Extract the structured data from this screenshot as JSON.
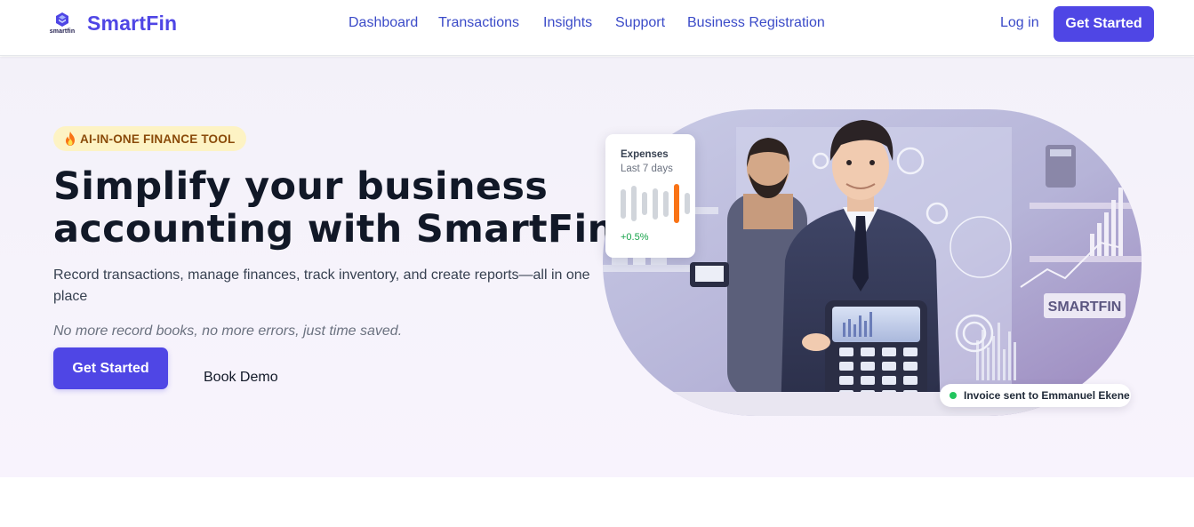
{
  "brand": {
    "name": "SmartFin",
    "logo_text": "smartfin"
  },
  "nav": {
    "items": [
      {
        "label": "Dashboard"
      },
      {
        "label": "Transactions"
      },
      {
        "label": "Insights"
      },
      {
        "label": "Support"
      },
      {
        "label": "Business Registration"
      }
    ],
    "login_label": "Log in",
    "cta_label": "Get Started"
  },
  "hero": {
    "badge": "AI-IN-ONE FINANCE TOOL",
    "headline": "Simplify your business accounting with SmartFin",
    "subtitle": "Record transactions, manage finances, track inventory, and create reports—all in one place",
    "tagline": "No more record books, no more errors, just time saved.",
    "primary_cta": "Get Started",
    "secondary_cta": "Book Demo"
  },
  "expense_card": {
    "title": "Expenses",
    "subtitle": "Last 7 days",
    "bars": [
      0.75,
      0.9,
      0.6,
      0.8,
      0.65,
      1.0,
      0.55
    ],
    "highlight_index": 5,
    "change": "+0.5%"
  },
  "illustration": {
    "sign_text": "SMARTFIN"
  },
  "toast": {
    "message": "Invoice sent to Emmanuel Ekene"
  },
  "colors": {
    "primary": "#4f46e5",
    "nav_link": "#3b4bc8",
    "badge_bg": "#fdf3c4",
    "badge_text": "#8a4b0a",
    "positive": "#16a34a",
    "highlight_bar": "#f97316",
    "status_dot": "#22c55e"
  }
}
